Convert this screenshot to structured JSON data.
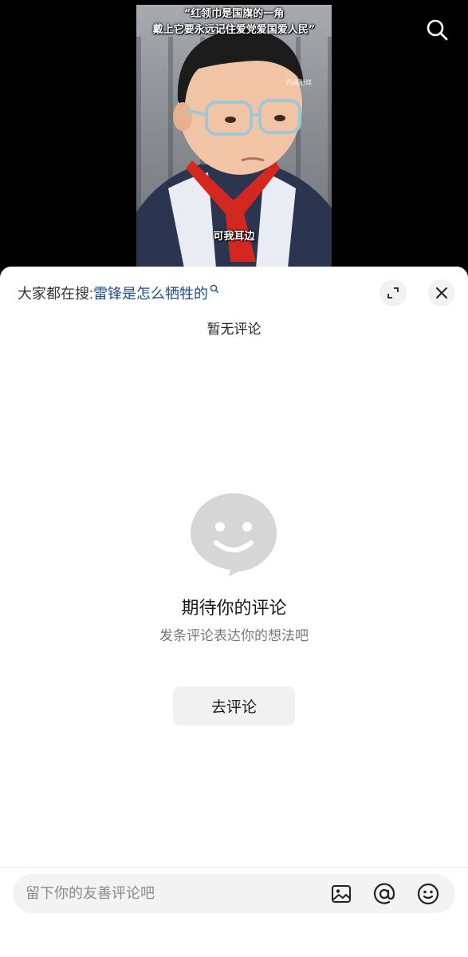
{
  "video": {
    "caption_line1": "“红领巾是国旗的一角",
    "caption_line2": "戴上它要永远记住爱党爱国爱人民”",
    "subtitle": "可我耳边",
    "watermark": "西藏融媒"
  },
  "sheet": {
    "search_prefix": "大家都在搜:",
    "search_term": "雷锋是怎么牺牲的",
    "no_comments": "暂无评论",
    "empty_title": "期待你的评论",
    "empty_subtitle": "发条评论表达你的想法吧",
    "go_comment_label": "去评论"
  },
  "input": {
    "placeholder": "留下你的友善评论吧"
  },
  "icons": {
    "top_right": "search-icon",
    "expand": "expand-icon",
    "close": "close-icon",
    "illustration": "smiley-bubble-icon",
    "image": "image-icon",
    "mention": "at-icon",
    "emoji": "emoji-icon"
  },
  "colors": {
    "search_term": "#1f4f8a",
    "sheet_bg": "#ffffff",
    "button_bg": "#f1f1f1",
    "illustration": "#d6d6d6"
  }
}
